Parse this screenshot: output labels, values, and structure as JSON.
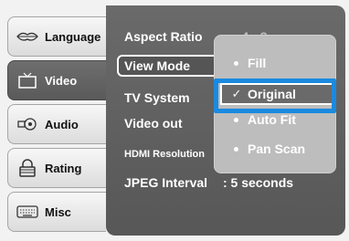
{
  "tabs": [
    {
      "label": "Language",
      "icon": "lips-icon"
    },
    {
      "label": "Video",
      "icon": "tv-icon",
      "active": true
    },
    {
      "label": "Audio",
      "icon": "speaker-icon"
    },
    {
      "label": "Rating",
      "icon": "lock-icon"
    },
    {
      "label": "Misc",
      "icon": "keyboard-icon"
    }
  ],
  "settings": {
    "aspect_ratio": {
      "label": "Aspect Ratio",
      "value": ": 4 : 3"
    },
    "view_mode": {
      "label": "View Mode"
    },
    "tv_system": {
      "label": "TV System"
    },
    "video_out": {
      "label": "Video out"
    },
    "hdmi_resolution": {
      "label": "HDMI Resolution"
    },
    "jpeg_interval": {
      "label": "JPEG Interval",
      "value": ": 5 seconds"
    }
  },
  "view_mode_options": [
    {
      "label": "Fill",
      "selected": false
    },
    {
      "label": "Original",
      "selected": true
    },
    {
      "label": "Auto Fit",
      "selected": false
    },
    {
      "label": "Pan Scan",
      "selected": false
    }
  ],
  "colors": {
    "focus": "#1a8ae0",
    "panel": "#5f5f5f"
  }
}
